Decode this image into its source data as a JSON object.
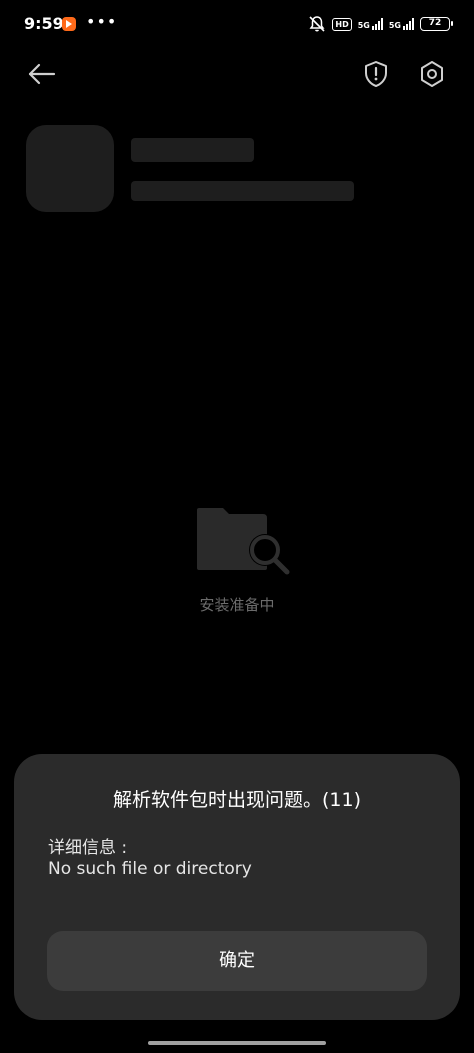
{
  "status_bar": {
    "time": "9:59",
    "more_dots": "•••",
    "hd_label": "HD",
    "net1": "5G",
    "net2": "5G",
    "battery": "72",
    "app_icon_color": "#ff6a1a"
  },
  "header": {
    "back_icon": "arrow-left-icon",
    "shield_icon": "shield-alert-icon",
    "settings_icon": "settings-hex-icon"
  },
  "main": {
    "status_text": "安装准备中",
    "illustration": "folder-search-icon"
  },
  "dialog": {
    "title": "解析软件包时出现问题。(11)",
    "detail_label": "详细信息 :",
    "detail_message": "No such file or directory",
    "ok_label": "确定"
  },
  "colors": {
    "background": "#000000",
    "placeholder": "#1e1e1e",
    "dialog_bg": "#2b2b2b",
    "button_bg": "#3c3c3c",
    "muted_text": "#6b6b6b"
  }
}
